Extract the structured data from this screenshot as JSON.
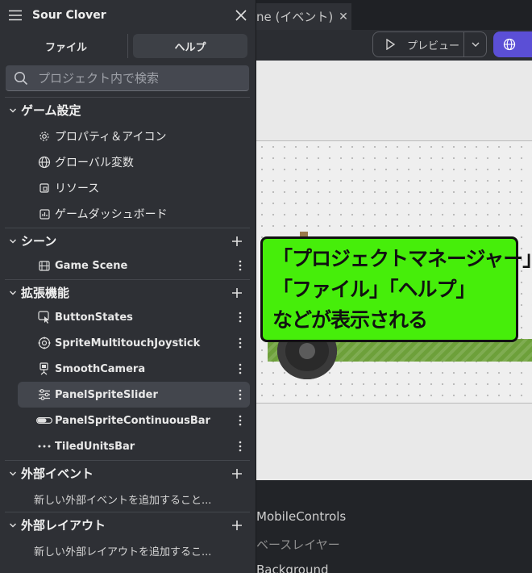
{
  "editor": {
    "scene_tab_label": "ne (イベント)",
    "preview_label": "プレビュー",
    "layers": [
      "MobileControls",
      "ベースレイヤー",
      "Background"
    ]
  },
  "callout": {
    "lines": [
      "「プロジェクトマネージャー」",
      "「ファイル」「ヘルプ」",
      "などが表示される"
    ]
  },
  "panel": {
    "title": "Sour Clover",
    "tabs": {
      "file": "ファイル",
      "help": "ヘルプ"
    },
    "search_placeholder": "プロジェクト内で検索",
    "sections": {
      "game_settings": {
        "title": "ゲーム設定",
        "items": [
          "プロパティ＆アイコン",
          "グローバル変数",
          "リソース",
          "ゲームダッシュボード"
        ]
      },
      "scenes": {
        "title": "シーン",
        "items": [
          "Game Scene"
        ]
      },
      "extensions": {
        "title": "拡張機能",
        "items": [
          "ButtonStates",
          "SpriteMultitouchJoystick",
          "SmoothCamera",
          "PanelSpriteSlider",
          "PanelSpriteContinuousBar",
          "TiledUnitsBar"
        ]
      },
      "external_events": {
        "title": "外部イベント",
        "hint": "新しい外部イベントを追加すること..."
      },
      "external_layouts": {
        "title": "外部レイアウト",
        "hint": "新しい外部レイアウトを追加するこ..."
      }
    }
  },
  "colors": {
    "panel_bg": "#2e3035",
    "callout_bg": "#46ee0a",
    "publish_button": "#5b4fd6",
    "ground": "#6da03a"
  }
}
